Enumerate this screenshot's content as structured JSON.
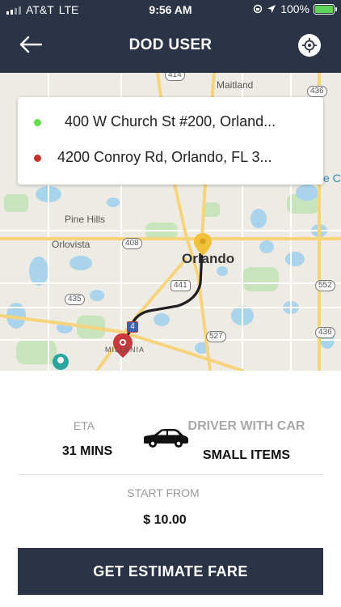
{
  "status_bar": {
    "carrier": "AT&T",
    "network": "LTE",
    "time": "9:56 AM",
    "battery": "100%"
  },
  "header": {
    "title": "DOD USER",
    "back_icon": "arrow-left-icon",
    "locate_icon": "crosshair-icon"
  },
  "route": {
    "pickup": "400 W Church St #200, Orland...",
    "dropoff": "4200 Conroy Rd, Orlando, FL 3..."
  },
  "map": {
    "labels": {
      "maitland": "Maitland",
      "pine_hills": "Pine Hills",
      "orlovista": "Orlovista",
      "orlando": "Orlando",
      "millenia": "MILLENIA",
      "partial_right": "e C"
    },
    "shields": {
      "r414": "414",
      "r436_top": "436",
      "r408": "408",
      "r441": "441",
      "r435": "435",
      "i4": "4",
      "r527": "527",
      "r552": "552",
      "r436_bottom": "436"
    },
    "colors": {
      "route_line": "#1f1f1f",
      "pickup_pin": "#f0c13a",
      "dropoff_pin": "#c9383b",
      "water": "#aad3ec",
      "park": "#c7e4bd",
      "highway": "#f7d37b"
    }
  },
  "trip": {
    "eta_label": "ETA",
    "eta_value": "31 MINS",
    "service_label": "DRIVER WITH CAR",
    "service_value": "SMALL ITEMS",
    "car_icon": "car-icon",
    "start_label": "START FROM",
    "start_value": "$ 10.00"
  },
  "cta": {
    "label": "GET ESTIMATE FARE"
  },
  "colors": {
    "header_bg": "#2b3446",
    "pickup_dot": "#61de4a",
    "dropoff_dot": "#c62f2f",
    "battery_fill": "#5fd35a"
  }
}
